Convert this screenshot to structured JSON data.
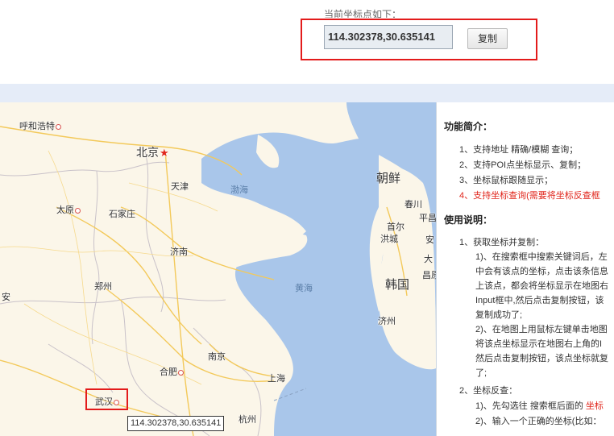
{
  "coords": {
    "caption": "当前坐标点如下：",
    "value": "114.302378,30.635141",
    "copy_label": "复制"
  },
  "map": {
    "cities": [
      {
        "name": "呼和浩特"
      },
      {
        "name": "北京"
      },
      {
        "name": "天津"
      },
      {
        "name": "太原"
      },
      {
        "name": "石家庄"
      },
      {
        "name": "济南"
      },
      {
        "name": "郑州"
      },
      {
        "name": "安"
      },
      {
        "name": "合肥"
      },
      {
        "name": "南京"
      },
      {
        "name": "上海"
      },
      {
        "name": "杭州"
      },
      {
        "name": "武汉"
      }
    ],
    "seas": [
      "渤海",
      "黄海"
    ],
    "countries": [
      "朝鲜",
      "韩国"
    ],
    "korea_cities": [
      "春川",
      "首尔",
      "平昌",
      "洪城",
      "安",
      "大",
      "昌原",
      "济州"
    ],
    "tooltip": "114.302378,30.635141"
  },
  "panel": {
    "features_title": "功能简介：",
    "features": [
      "1、支持地址 精确/模糊 查询；",
      "2、支持POI点坐标显示、复制；",
      "3、坐标鼠标跟随显示；",
      "4、支持坐标查询(需要将坐标反查框"
    ],
    "usage_title": "使用说明：",
    "usage_lines": [
      "1、获取坐标并复制：",
      "1)、在搜索框中搜索关键词后，左",
      "中会有该点的坐标，点击该条信息",
      "上该点，都会将坐标显示在地图右",
      "Input框中,然后点击复制按钮，该",
      "复制成功了;",
      "2)、在地图上用鼠标左键单击地图",
      "将该点坐标显示在地图右上角的I",
      "然后点击复制按钮，该点坐标就复",
      "了;",
      "2、坐标反查：",
      "1)、先勾选往 搜索框后面的",
      "坐标",
      "2)、输入一个正确的坐标(比如："
    ]
  }
}
